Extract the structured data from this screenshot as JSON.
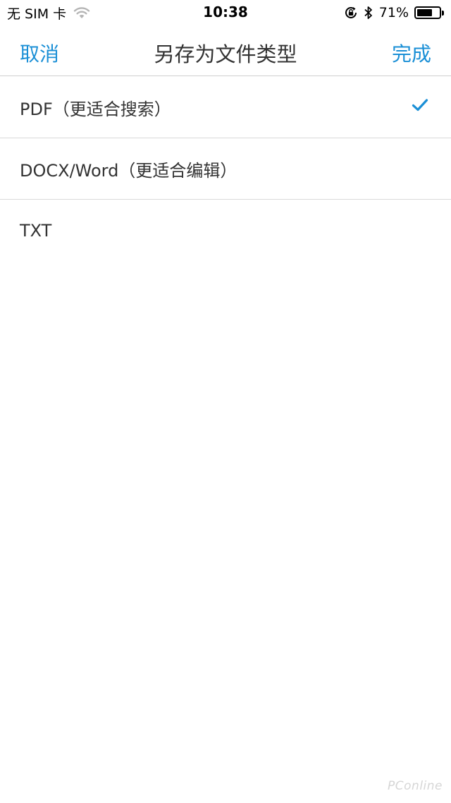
{
  "status_bar": {
    "carrier": "无 SIM 卡",
    "time": "10:38",
    "battery_percent": "71%",
    "battery_level": 0.71,
    "icons": [
      "wifi-icon",
      "lock-rotation-icon",
      "bluetooth-icon",
      "battery-icon"
    ]
  },
  "nav": {
    "cancel_label": "取消",
    "title": "另存为文件类型",
    "done_label": "完成",
    "accent_color": "#1a8fd6"
  },
  "file_types": [
    {
      "label": "PDF（更适合搜索）",
      "selected": true
    },
    {
      "label": "DOCX/Word（更适合编辑）",
      "selected": false
    },
    {
      "label": "TXT",
      "selected": false
    }
  ],
  "watermark": "PConline"
}
